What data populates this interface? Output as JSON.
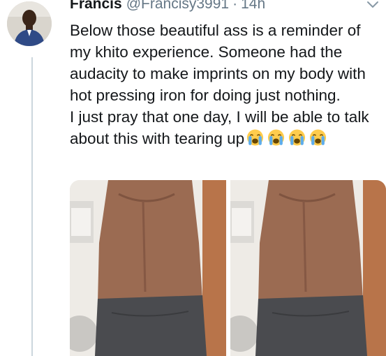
{
  "tweet": {
    "display_name": "Francis",
    "handle": "@Francisy3991",
    "separator": "·",
    "timestamp": "14h",
    "text_line_1": "Below those beautiful ass is a reminder of my khito experience. Someone had the audacity to make imprints on my body with hot pressing iron for doing just nothing.",
    "text_line_2": "I just pray that one day, I will be able to talk about this with tearing up",
    "emojis": [
      "loudly-crying-face-emoji",
      "loudly-crying-face-emoji",
      "loudly-crying-face-emoji",
      "loudly-crying-face-emoji"
    ]
  },
  "icons": {
    "menu": "chevron-down-icon",
    "avatar": "avatar-photo"
  },
  "colors": {
    "text_primary": "#14171a",
    "text_secondary": "#657786",
    "thread_line": "#ccd6dd",
    "background": "#ffffff"
  },
  "media": {
    "count": 2
  }
}
